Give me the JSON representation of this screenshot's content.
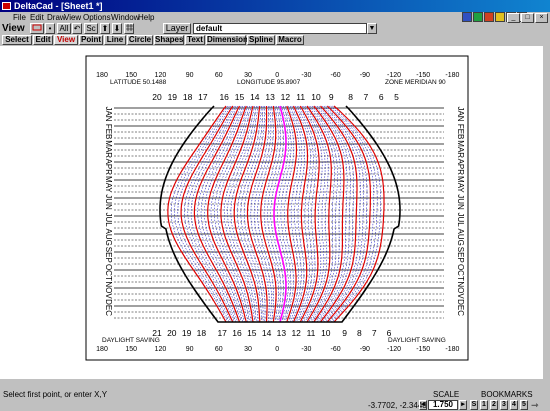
{
  "window": {
    "title": "DeltaCad - [Sheet1 *]"
  },
  "menu": [
    "File",
    "Edit",
    "Draw",
    "View",
    "Options",
    "Window",
    "Help"
  ],
  "sys_buttons": [
    "_",
    "□",
    "×"
  ],
  "toolbar": {
    "view_label": "View",
    "all_label": "All",
    "sc_label": "Sc",
    "layer_label": "Layer",
    "layer_value": "default"
  },
  "tabs": [
    "Select",
    "Edit",
    "View",
    "Point",
    "Line",
    "Circle",
    "Shapes",
    "Text",
    "Dimension",
    "Spline",
    "Macro"
  ],
  "active_tab": "View",
  "drawing": {
    "top_longitudes": [
      "180",
      "150",
      "120",
      "90",
      "60",
      "30",
      "0",
      "-30",
      "-60",
      "-90",
      "-120",
      "-150",
      "-180"
    ],
    "bottom_longitudes": [
      "180",
      "150",
      "120",
      "90",
      "60",
      "30",
      "0",
      "-30",
      "-60",
      "-90",
      "-120",
      "-150",
      "-180"
    ],
    "latitude_label": "LATITUDE 50.1488",
    "longitude_label": "LONGITUDE 95.8907",
    "zone_label": "ZONE MERIDIAN 90",
    "top_hours": [
      "20",
      "19",
      "18",
      "17",
      "16",
      "15",
      "14",
      "13",
      "12",
      "11",
      "10",
      "9",
      "8",
      "7",
      "6",
      "5"
    ],
    "bottom_hours": [
      "21",
      "20",
      "19",
      "18",
      "17",
      "16",
      "15",
      "14",
      "13",
      "12",
      "11",
      "10",
      "9",
      "8",
      "7",
      "6"
    ],
    "months": [
      "JAN",
      "FEB",
      "MAR",
      "APR",
      "MAY",
      "JUN",
      "JUL",
      "AUG",
      "SEP",
      "OCT",
      "NOV",
      "DEC"
    ],
    "daylight_left": "DAYLIGHT SAVING",
    "daylight_right": "DAYLIGHT SAVING",
    "colors": {
      "hour_line": "#e00000",
      "half_line": "#0000c0",
      "noon_line": "#ff00ff",
      "outline": "#000000"
    }
  },
  "status": {
    "prompt": "Select first point, or enter X,Y",
    "coords": "-3.7702, -2.3448",
    "scale_label": "SCALE",
    "scale_value": "1.750",
    "bookmarks_label": "BOOKMARKS",
    "bookmarks": [
      "S",
      "1",
      "2",
      "3",
      "4",
      "5"
    ]
  }
}
